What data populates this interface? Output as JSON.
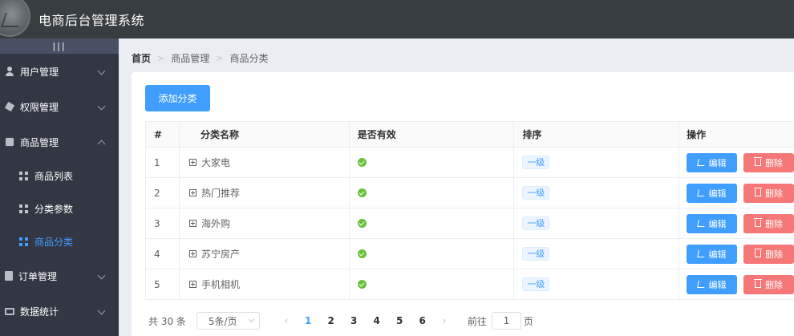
{
  "header": {
    "title": "电商后台管理系统"
  },
  "sidebar": {
    "toggle": "|||",
    "menus": [
      {
        "label": "用户管理",
        "icon": "user-icon"
      },
      {
        "label": "权限管理",
        "icon": "cube-icon"
      },
      {
        "label": "商品管理",
        "icon": "bag-icon",
        "expanded": true,
        "children": [
          {
            "label": "商品列表",
            "icon": "grid-icon"
          },
          {
            "label": "分类参数",
            "icon": "grid-icon"
          },
          {
            "label": "商品分类",
            "icon": "grid-icon",
            "active": true
          }
        ]
      },
      {
        "label": "订单管理",
        "icon": "document-icon"
      },
      {
        "label": "数据统计",
        "icon": "monitor-icon"
      }
    ]
  },
  "breadcrumb": [
    "首页",
    "商品管理",
    "商品分类"
  ],
  "toolbar": {
    "add_label": "添加分类"
  },
  "table": {
    "headers": [
      "#",
      "分类名称",
      "是否有效",
      "排序",
      "操作"
    ],
    "rows": [
      {
        "index": "1",
        "name": "大家电",
        "level": "一级"
      },
      {
        "index": "2",
        "name": "热门推荐",
        "level": "一级"
      },
      {
        "index": "3",
        "name": "海外购",
        "level": "一级"
      },
      {
        "index": "4",
        "name": "苏宁房产",
        "level": "一级"
      },
      {
        "index": "5",
        "name": "手机相机",
        "level": "一级"
      }
    ],
    "edit_label": "编辑",
    "delete_label": "删除"
  },
  "pagination": {
    "total": "共 30 条",
    "page_size": "5条/页",
    "pages": [
      "1",
      "2",
      "3",
      "4",
      "5",
      "6"
    ],
    "current": "1",
    "prev": "‹",
    "next": "›",
    "jump_prefix": "前往",
    "jump_value": "1",
    "jump_suffix": "页"
  },
  "colors": {
    "primary": "#409eff",
    "danger": "#f56c6c",
    "success": "#67c23a",
    "sidebar": "#333744",
    "header": "#373d41"
  }
}
